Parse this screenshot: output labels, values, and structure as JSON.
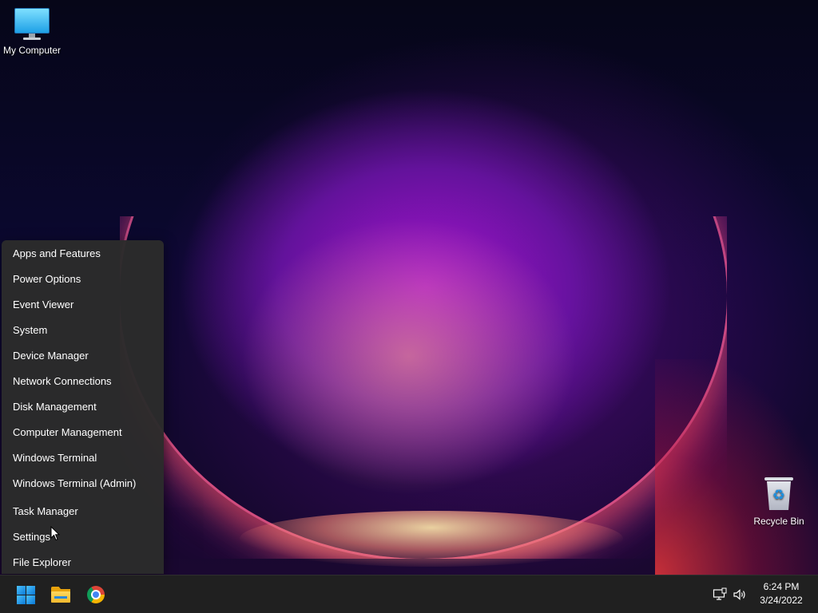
{
  "desktop": {
    "icons": [
      {
        "label": "My Computer",
        "icon": "computer-icon"
      },
      {
        "label": "Recycle Bin",
        "icon": "recycle-bin-icon"
      }
    ]
  },
  "context_menu": {
    "items": [
      "Apps and Features",
      "Power Options",
      "Event Viewer",
      "System",
      "Device Manager",
      "Network Connections",
      "Disk Management",
      "Computer Management",
      "Windows Terminal",
      "Windows Terminal (Admin)",
      "Task Manager",
      "Settings",
      "File Explorer"
    ]
  },
  "taskbar": {
    "pinned": [
      {
        "name": "Start",
        "icon": "windows-logo-icon"
      },
      {
        "name": "File Explorer",
        "icon": "folder-icon"
      },
      {
        "name": "Google Chrome",
        "icon": "chrome-icon"
      }
    ],
    "tray": {
      "icons": [
        "network-icon",
        "volume-icon"
      ],
      "time": "6:24 PM",
      "date": "3/24/2022"
    }
  },
  "colors": {
    "taskbar_bg": "#202020",
    "menu_bg": "#2b2b2b",
    "accent": "#0a78d4",
    "text": "#ffffff"
  }
}
